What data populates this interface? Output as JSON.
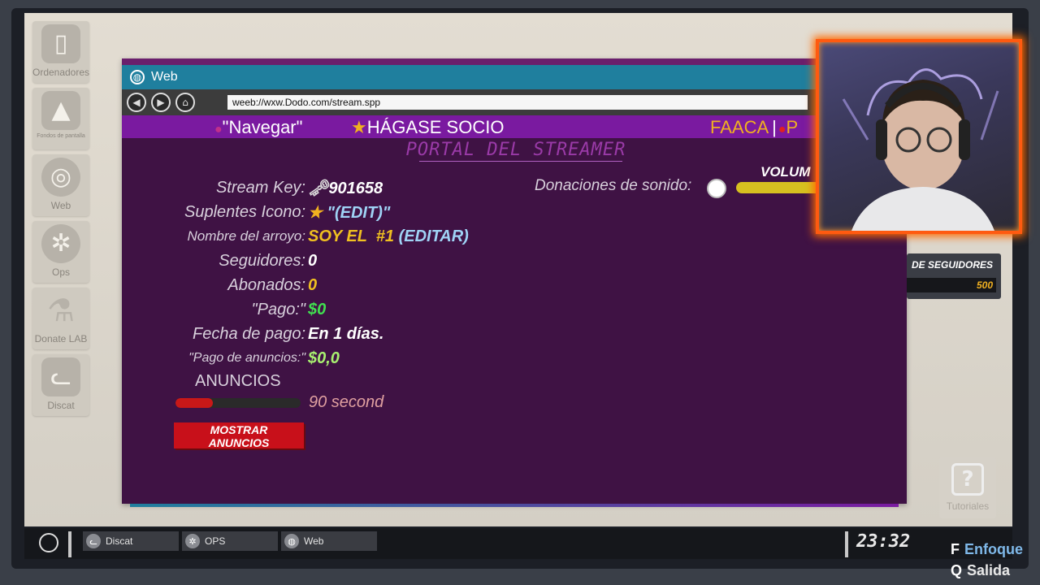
{
  "desktop": {
    "icons": [
      {
        "name": "Ordenadores",
        "icon": "computer-tower-icon"
      },
      {
        "name": "Fondos de pantalla",
        "icon": "image-icon"
      },
      {
        "name": "Web",
        "icon": "globe-icon"
      },
      {
        "name": "Ops",
        "icon": "shuriken-icon"
      },
      {
        "name": "Donate LAB",
        "icon": "flask-icon"
      },
      {
        "name": "Discat",
        "icon": "cat-icon"
      }
    ],
    "tutorial_label": "Tutoriales"
  },
  "window": {
    "title": "Web",
    "url": "weeb://wxw.Dodo.com/stream.spp"
  },
  "site": {
    "nav_label": "\"Navegar\"",
    "partner_label": "HÁGASE SOCIO",
    "faq_label": "FAACA",
    "faq_sep": "|",
    "partial_label": "P",
    "portal_title": "PORTAL DEL STREAMER"
  },
  "stream": {
    "rows": [
      {
        "label": "Stream Key:",
        "value": "901658",
        "color": "#ffffff"
      },
      {
        "label": "Suplentes Icono:",
        "value": "\"(EDIT)\"",
        "color": "#9fd3f5"
      },
      {
        "label": "Nombre del arroyo:",
        "value": "SOY EL  #1",
        "value2": "(EDITAR)",
        "color": "#f0c020",
        "color2": "#9fd3f5"
      },
      {
        "label": "Seguidores:",
        "value": "0",
        "color": "#ffffff"
      },
      {
        "label": "Abonados:",
        "value": "0",
        "color": "#f0c020"
      },
      {
        "label": "\"Pago:\"",
        "value": "$0",
        "color": "#40e050"
      },
      {
        "label": "Fecha de pago:",
        "value": "En 1 días.",
        "color": "#ffffff"
      },
      {
        "label": "\"Pago de anuncios:\"",
        "value": "$0,0",
        "color": "#a8f070"
      }
    ],
    "ads_label": "ANUNCIOS",
    "ads_progress": 0.3,
    "ads_time": "90 second",
    "show_ads_button": "MOSTRAR ANUNCIOS",
    "donations_label": "Donaciones de sonido:",
    "volume_label": "VOLUM"
  },
  "followers_widget": {
    "title": "DE SEGUIDORES",
    "value": "500"
  },
  "taskbar": {
    "tasks": [
      {
        "label": "Discat",
        "icon": "cat-icon"
      },
      {
        "label": "OPS",
        "icon": "shuriken-icon"
      },
      {
        "label": "Web",
        "icon": "globe-icon"
      }
    ],
    "clock": "23:32"
  },
  "hints": [
    {
      "key": "F",
      "label": "Enfoque"
    },
    {
      "key": "Q",
      "label": "Salida"
    }
  ]
}
